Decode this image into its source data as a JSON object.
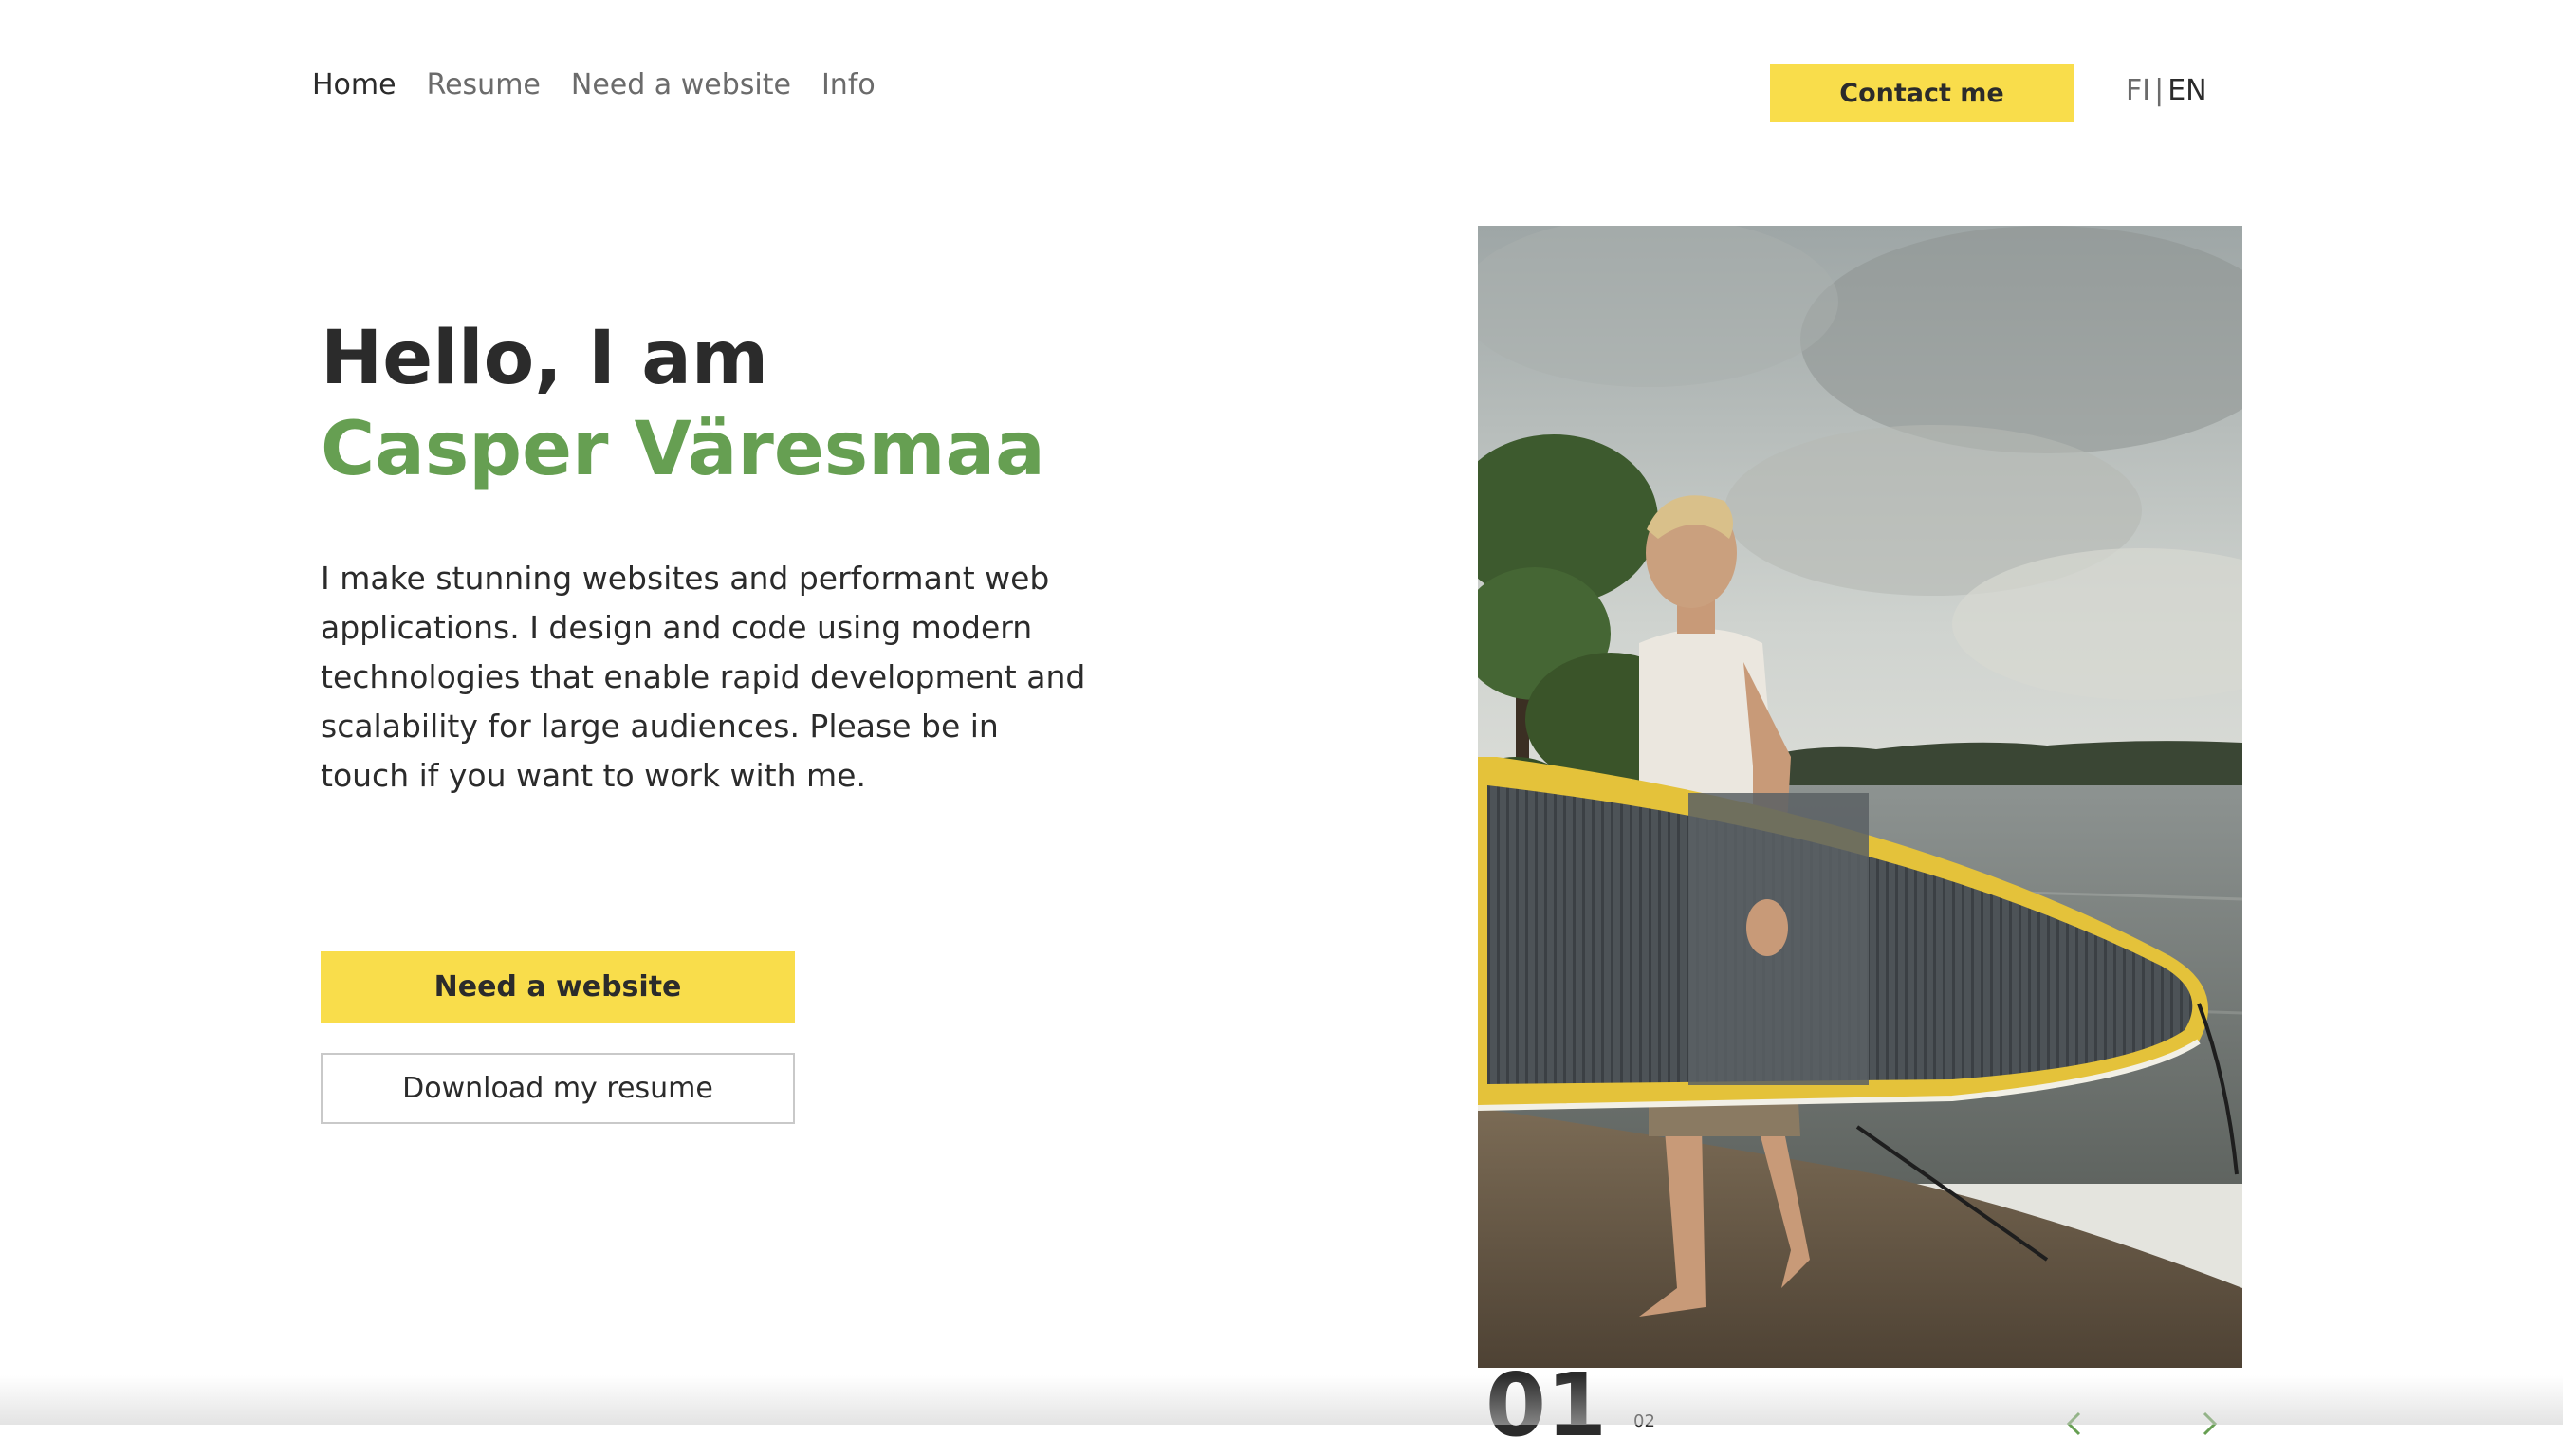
{
  "nav": {
    "items": [
      {
        "label": "Home",
        "active": true
      },
      {
        "label": "Resume",
        "active": false
      },
      {
        "label": "Need a website",
        "active": false
      },
      {
        "label": "Info",
        "active": false
      }
    ],
    "contact_label": "Contact me",
    "lang": {
      "fi": "FI",
      "separator": "|",
      "en": "EN",
      "selected": "EN"
    }
  },
  "hero": {
    "greeting": "Hello, I am",
    "name": "Casper Väresmaa",
    "intro": "I make stunning websites and performant web applications. I design and code using modern technologies that enable rapid development and scalability for large audiences. Please be in touch if you want to work with me.",
    "primary_button": "Need a website",
    "secondary_button": "Download my resume"
  },
  "slider": {
    "current": "01",
    "total": "02",
    "prev_icon": "chevron-left-icon",
    "next_icon": "chevron-right-icon"
  },
  "colors": {
    "accent_yellow": "#f9dd4b",
    "name_green": "#669f52",
    "text_dark": "#2b2b2b",
    "text_muted": "#6b6b6b"
  }
}
